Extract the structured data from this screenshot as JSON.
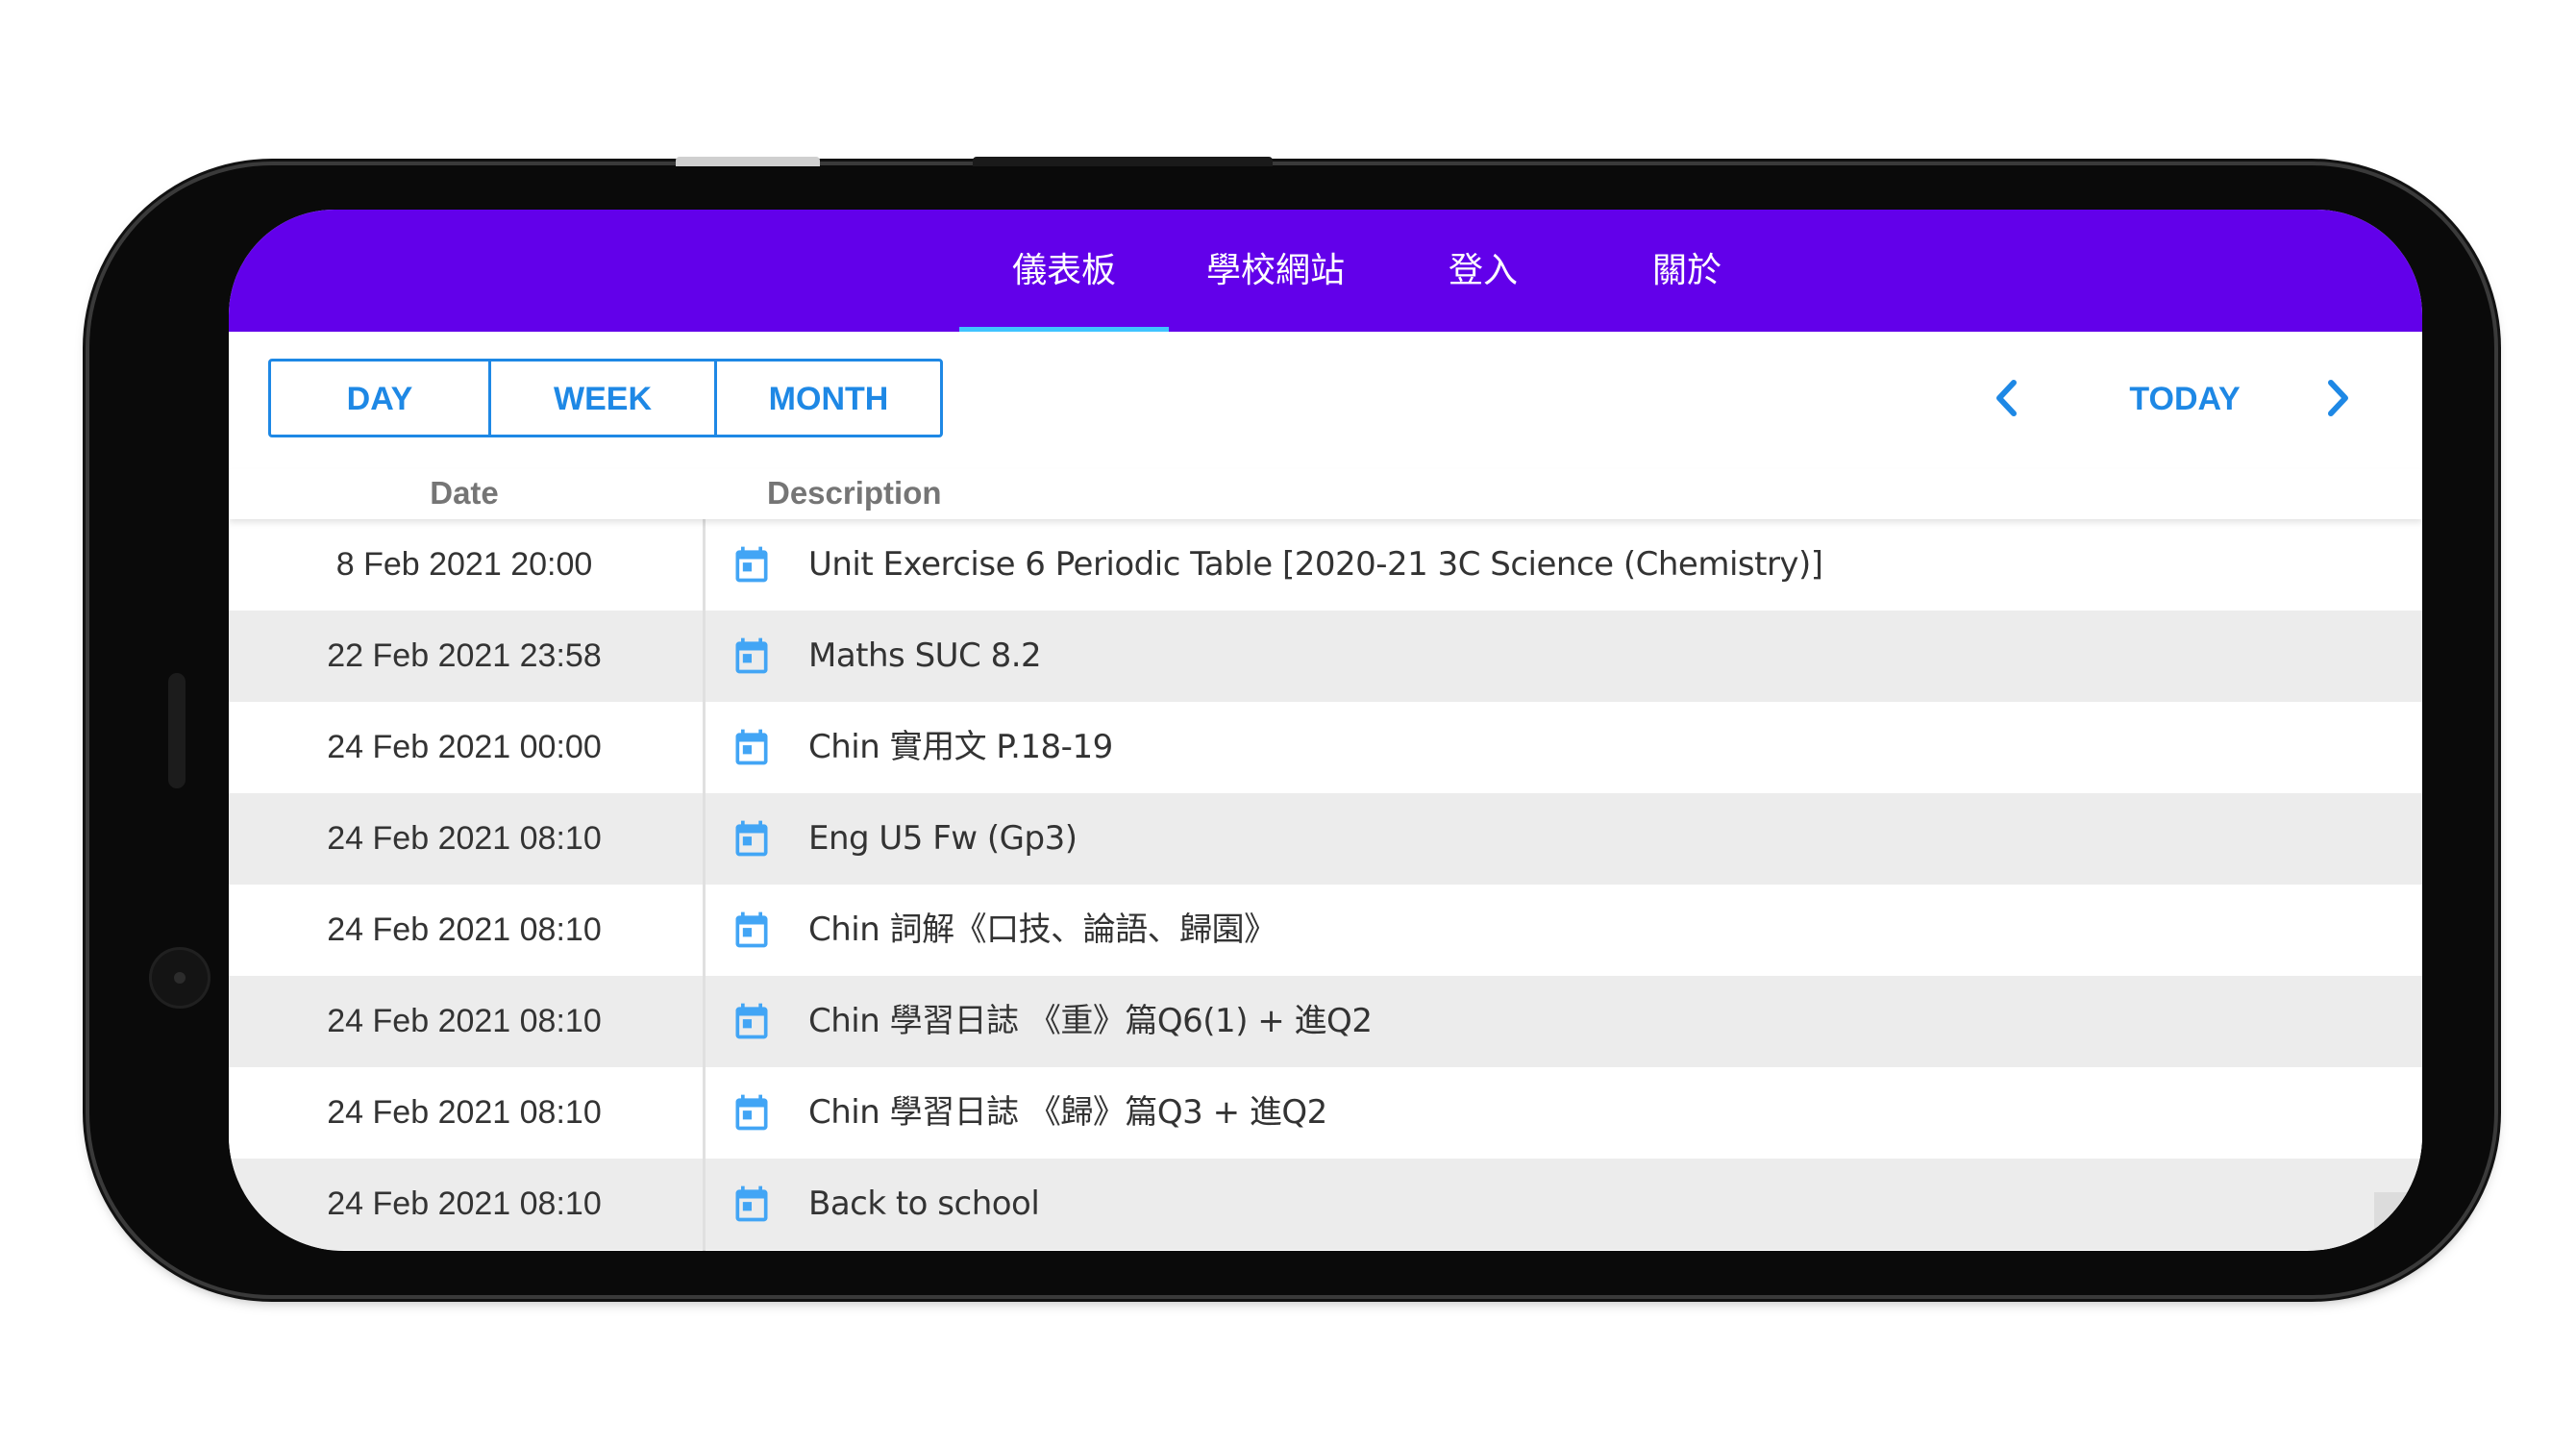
{
  "nav": {
    "tabs": [
      {
        "label": "儀表板",
        "active": true
      },
      {
        "label": "學校網站",
        "active": false
      },
      {
        "label": "登入",
        "active": false
      },
      {
        "label": "關於",
        "active": false
      }
    ],
    "bar_color": "#6200ea",
    "indicator_color": "#40c4ff"
  },
  "toolbar": {
    "view_day": "DAY",
    "view_week": "WEEK",
    "view_month": "MONTH",
    "today": "TODAY",
    "prev_icon": "chevron-left-icon",
    "next_icon": "chevron-right-icon",
    "accent_color": "#1e88e5"
  },
  "table": {
    "headers": {
      "date": "Date",
      "description": "Description"
    },
    "row_icon": "calendar-icon",
    "rows": [
      {
        "date": "8 Feb 2021 20:00",
        "description": "Unit Exercise 6 Periodic Table [2020-21 3C Science (Chemistry)]"
      },
      {
        "date": "22 Feb 2021 23:58",
        "description": "Maths SUC 8.2"
      },
      {
        "date": "24 Feb 2021 00:00",
        "description": "Chin 實用文 P.18-19"
      },
      {
        "date": "24 Feb 2021 08:10",
        "description": "Eng U5 Fw (Gp3)"
      },
      {
        "date": "24 Feb 2021 08:10",
        "description": "Chin 詞解《口技、論語、歸園》"
      },
      {
        "date": "24 Feb 2021 08:10",
        "description": "Chin 學習日誌 《重》篇Q6(1) + 進Q2"
      },
      {
        "date": "24 Feb 2021 08:10",
        "description": "Chin 學習日誌 《歸》篇Q3 + 進Q2"
      },
      {
        "date": "24 Feb 2021 08:10",
        "description": "Back to school"
      }
    ]
  }
}
